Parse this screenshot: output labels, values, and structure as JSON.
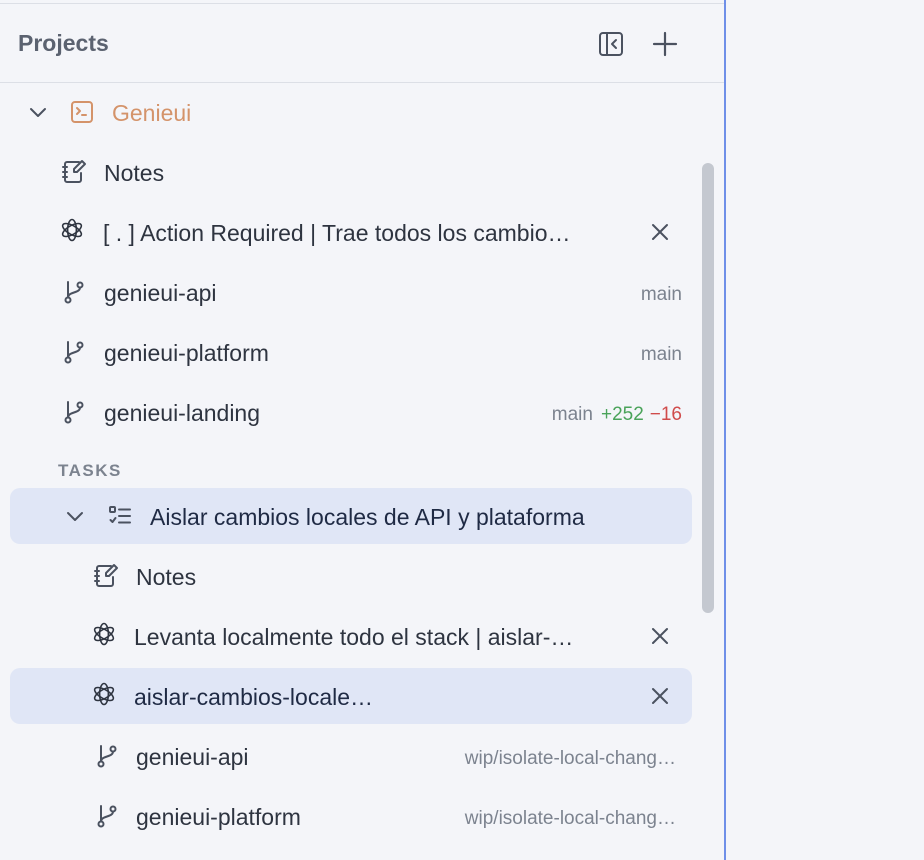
{
  "header": {
    "title": "Projects",
    "collapse_icon": "collapse-sidebar-icon",
    "add_icon": "plus-icon"
  },
  "project": {
    "name": "Genieui",
    "color": "#d4936a",
    "items": [
      {
        "type": "notes",
        "label": "Notes"
      },
      {
        "type": "chat",
        "label": "[ . ] Action Required | Trae todos los cambio…"
      },
      {
        "type": "repo",
        "label": "genieui-api",
        "branch": "main"
      },
      {
        "type": "repo",
        "label": "genieui-platform",
        "branch": "main"
      },
      {
        "type": "repo",
        "label": "genieui-landing",
        "branch": "main",
        "added": "+252",
        "removed": "−16"
      }
    ]
  },
  "tasks": {
    "section_label": "TASKS",
    "task": {
      "title": "Aislar cambios locales de API y plataforma",
      "items": [
        {
          "type": "notes",
          "label": "Notes"
        },
        {
          "type": "chat",
          "label": "Levanta localmente todo el stack | aislar-…"
        },
        {
          "type": "chat",
          "label": "aislar-cambios-locale…"
        },
        {
          "type": "repo",
          "label": "genieui-api",
          "branch": "wip/isolate-local-chang…"
        },
        {
          "type": "repo",
          "label": "genieui-platform",
          "branch": "wip/isolate-local-chang…"
        }
      ]
    }
  },
  "colors": {
    "accent_border": "#6f8fe8",
    "selected_bg": "#e0e6f6",
    "diff_added": "#4aa35a",
    "diff_removed": "#d04b4b"
  }
}
